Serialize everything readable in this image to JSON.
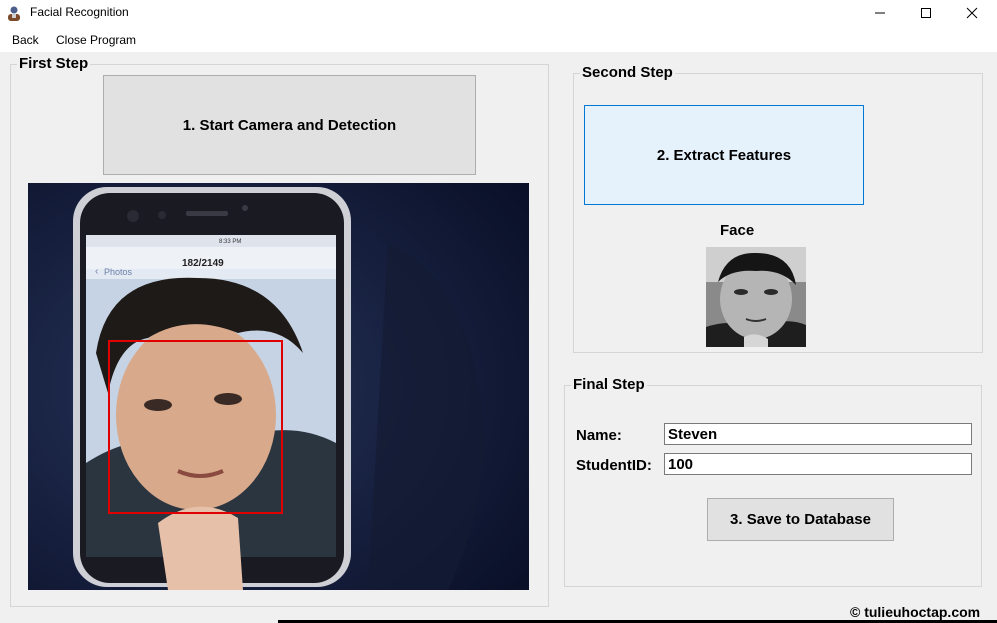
{
  "window": {
    "title": "Facial Recognition",
    "icons": {
      "app": "user-avatar-icon",
      "minimize": "minimize-icon",
      "maximize": "maximize-icon",
      "close": "close-icon"
    }
  },
  "menu": {
    "back": "Back",
    "close_program": "Close Program"
  },
  "first_step": {
    "title": "First Step",
    "start_button": "1. Start Camera and Detection",
    "phone_screen": {
      "time": "8:33 PM",
      "back_label": "Photos",
      "counter": "182/2149"
    }
  },
  "second_step": {
    "title": "Second Step",
    "extract_button": "2. Extract Features",
    "face_label": "Face"
  },
  "final_step": {
    "title": "Final Step",
    "name_label": "Name:",
    "name_value": "Steven",
    "student_id_label": "StudentID:",
    "student_id_value": "100",
    "save_button": "3. Save  to Database"
  },
  "watermark": "© tulieuhoctap.com",
  "colors": {
    "detection_box": "#e00000",
    "primary_border": "#0078d7",
    "primary_fill": "#e5f1fb"
  }
}
